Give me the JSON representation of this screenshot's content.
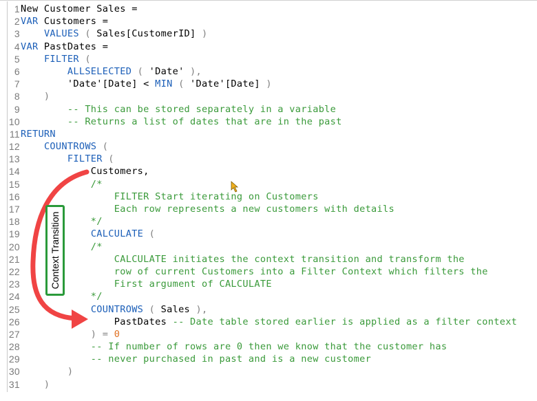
{
  "editor": {
    "lines": [
      {
        "n": "1",
        "parts": [
          {
            "t": "New Customer Sales =",
            "c": ""
          }
        ]
      },
      {
        "n": "2",
        "parts": [
          {
            "t": "VAR",
            "c": "kw"
          },
          {
            "t": " Customers =",
            "c": ""
          }
        ]
      },
      {
        "n": "3",
        "parts": [
          {
            "t": "    ",
            "c": ""
          },
          {
            "t": "VALUES",
            "c": "kw"
          },
          {
            "t": " ( ",
            "c": "pn"
          },
          {
            "t": "Sales[CustomerID]",
            "c": ""
          },
          {
            "t": " )",
            "c": "pn"
          }
        ]
      },
      {
        "n": "4",
        "parts": [
          {
            "t": "VAR",
            "c": "kw"
          },
          {
            "t": " PastDates =",
            "c": ""
          }
        ]
      },
      {
        "n": "5",
        "parts": [
          {
            "t": "    ",
            "c": ""
          },
          {
            "t": "FILTER",
            "c": "kw"
          },
          {
            "t": " (",
            "c": "pn"
          }
        ]
      },
      {
        "n": "6",
        "parts": [
          {
            "t": "        ",
            "c": ""
          },
          {
            "t": "ALLSELECTED",
            "c": "kw"
          },
          {
            "t": " ( ",
            "c": "pn"
          },
          {
            "t": "'Date'",
            "c": ""
          },
          {
            "t": " ),",
            "c": "pn"
          }
        ]
      },
      {
        "n": "7",
        "parts": [
          {
            "t": "        'Date'[Date] < ",
            "c": ""
          },
          {
            "t": "MIN",
            "c": "kw"
          },
          {
            "t": " ( ",
            "c": "pn"
          },
          {
            "t": "'Date'[Date]",
            "c": ""
          },
          {
            "t": " )",
            "c": "pn"
          }
        ]
      },
      {
        "n": "8",
        "parts": [
          {
            "t": "    )",
            "c": "pn"
          }
        ]
      },
      {
        "n": "9",
        "parts": [
          {
            "t": "        -- This can be stored separately in a variable",
            "c": "cm"
          }
        ]
      },
      {
        "n": "10",
        "parts": [
          {
            "t": "        -- Returns a list of dates that are in the past",
            "c": "cm"
          }
        ]
      },
      {
        "n": "11",
        "parts": [
          {
            "t": "RETURN",
            "c": "kw"
          }
        ]
      },
      {
        "n": "12",
        "parts": [
          {
            "t": "    ",
            "c": ""
          },
          {
            "t": "COUNTROWS",
            "c": "kw"
          },
          {
            "t": " (",
            "c": "pn"
          }
        ]
      },
      {
        "n": "13",
        "parts": [
          {
            "t": "        ",
            "c": ""
          },
          {
            "t": "FILTER",
            "c": "kw"
          },
          {
            "t": " (",
            "c": "pn"
          }
        ]
      },
      {
        "n": "14",
        "parts": [
          {
            "t": "            Customers,",
            "c": ""
          }
        ]
      },
      {
        "n": "15",
        "parts": [
          {
            "t": "            /*",
            "c": "cm"
          }
        ]
      },
      {
        "n": "16",
        "parts": [
          {
            "t": "                FILTER Start iterating on Customers",
            "c": "cm"
          }
        ]
      },
      {
        "n": "17",
        "parts": [
          {
            "t": "                Each row represents a new customers with details",
            "c": "cm"
          }
        ]
      },
      {
        "n": "18",
        "parts": [
          {
            "t": "            */",
            "c": "cm"
          }
        ]
      },
      {
        "n": "19",
        "parts": [
          {
            "t": "            ",
            "c": ""
          },
          {
            "t": "CALCULATE",
            "c": "kw"
          },
          {
            "t": " (",
            "c": "pn"
          }
        ]
      },
      {
        "n": "20",
        "parts": [
          {
            "t": "            /*",
            "c": "cm"
          }
        ]
      },
      {
        "n": "21",
        "parts": [
          {
            "t": "                CALCULATE initiates the context transition and transform the",
            "c": "cm"
          }
        ]
      },
      {
        "n": "22",
        "parts": [
          {
            "t": "                row of current Customers into a Filter Context which filters the",
            "c": "cm"
          }
        ]
      },
      {
        "n": "23",
        "parts": [
          {
            "t": "                First argument of CALCULATE",
            "c": "cm"
          }
        ]
      },
      {
        "n": "24",
        "parts": [
          {
            "t": "            */",
            "c": "cm"
          }
        ]
      },
      {
        "n": "25",
        "parts": [
          {
            "t": "            ",
            "c": ""
          },
          {
            "t": "COUNTROWS",
            "c": "kw"
          },
          {
            "t": " ( ",
            "c": "pn"
          },
          {
            "t": "Sales",
            "c": ""
          },
          {
            "t": " ),",
            "c": "pn"
          }
        ]
      },
      {
        "n": "26",
        "parts": [
          {
            "t": "                PastDates ",
            "c": ""
          },
          {
            "t": "-- Date table stored earlier is applied as a filter context",
            "c": "cm"
          }
        ]
      },
      {
        "n": "27",
        "parts": [
          {
            "t": "            ) = ",
            "c": "pn"
          },
          {
            "t": "0",
            "c": "num"
          }
        ]
      },
      {
        "n": "28",
        "parts": [
          {
            "t": "            -- If number of rows are 0 then we know that the customer has",
            "c": "cm"
          }
        ]
      },
      {
        "n": "29",
        "parts": [
          {
            "t": "            -- never purchased in past and is a new customer",
            "c": "cm"
          }
        ]
      },
      {
        "n": "30",
        "parts": [
          {
            "t": "        )",
            "c": "pn"
          }
        ]
      },
      {
        "n": "31",
        "parts": [
          {
            "t": "    )",
            "c": "pn"
          }
        ]
      }
    ]
  },
  "annotation": {
    "label": "Context Transition",
    "arrow_color": "#f04444",
    "box_color": "#2a9a3a"
  }
}
